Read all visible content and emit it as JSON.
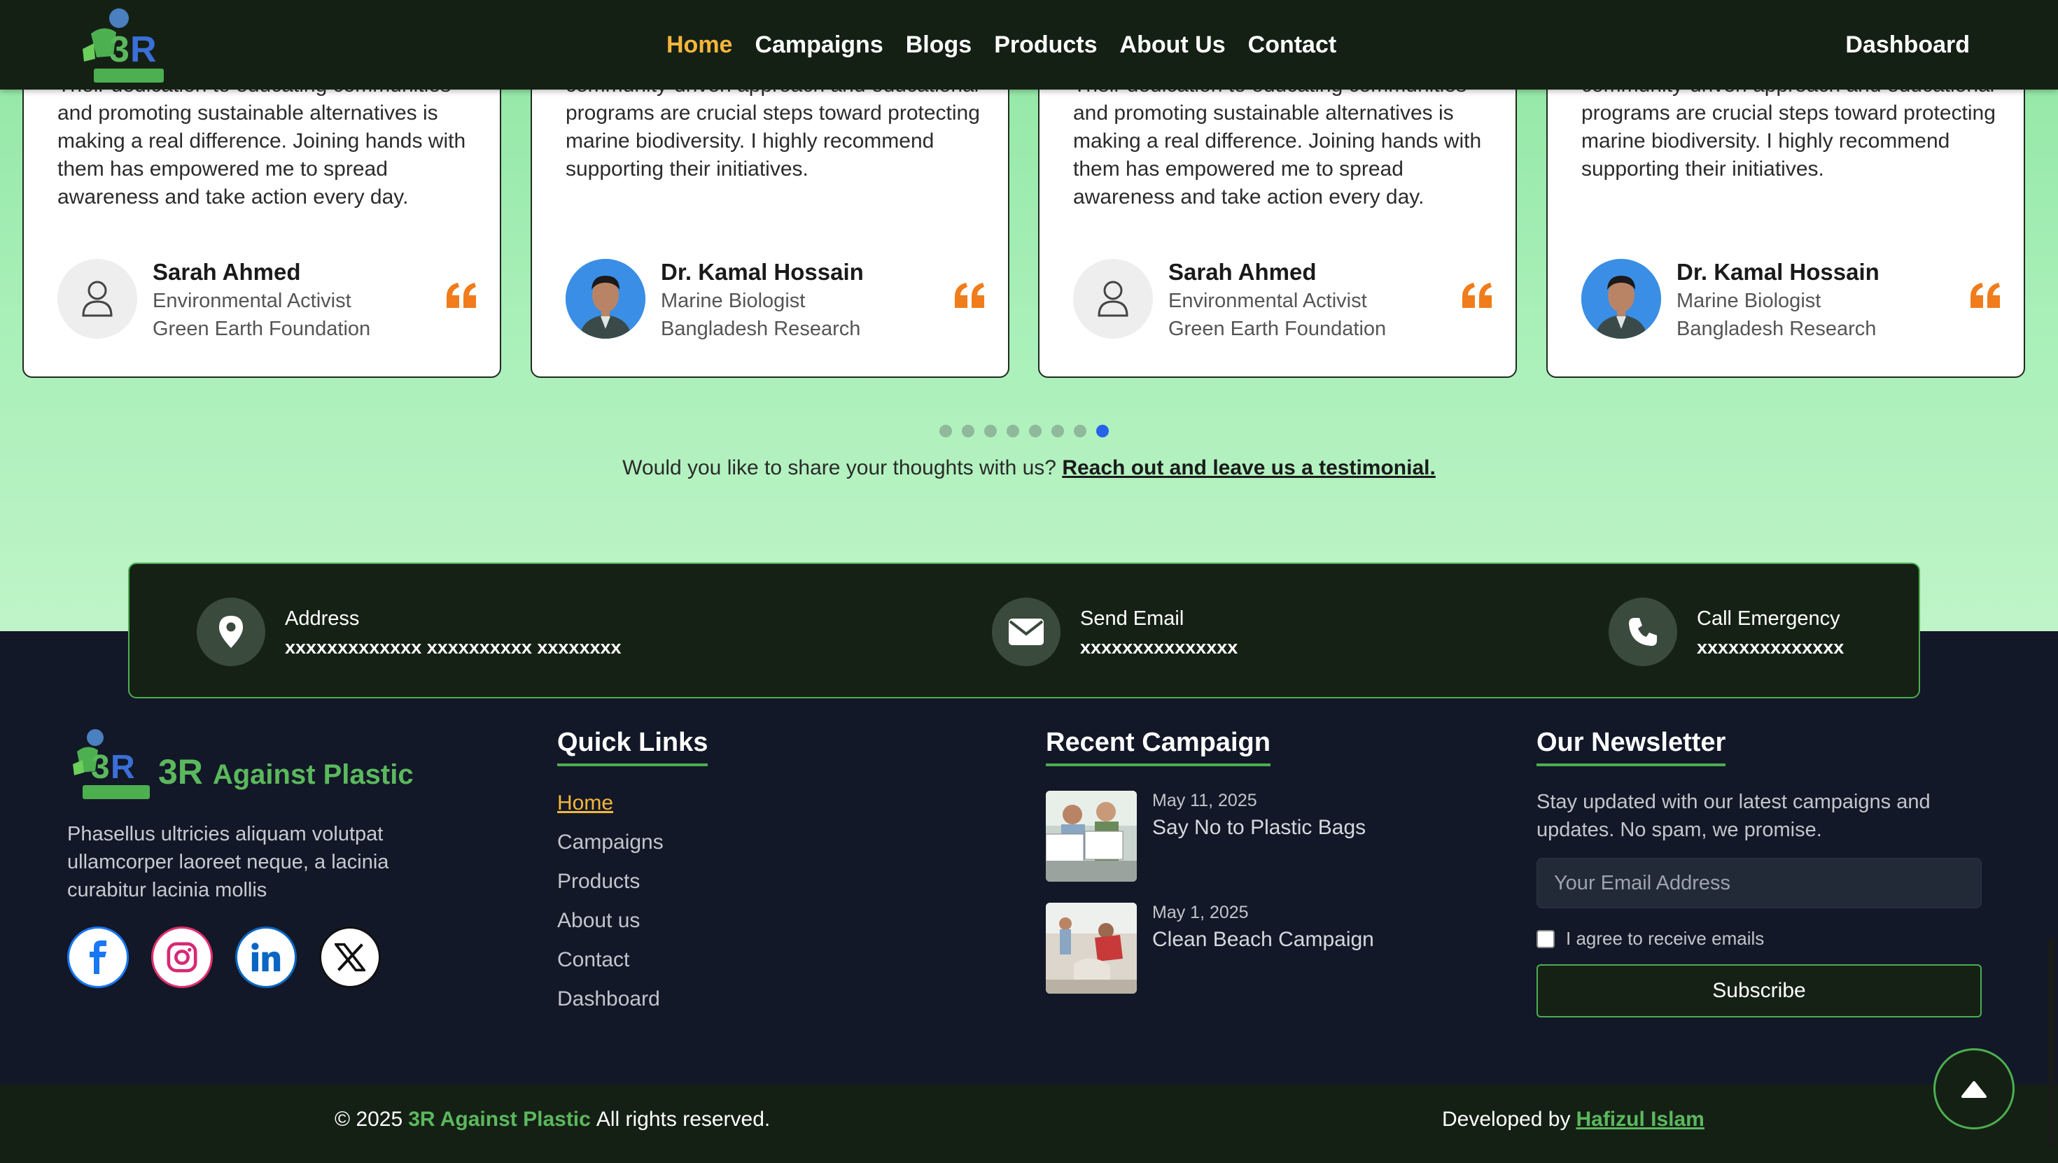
{
  "nav": {
    "links": [
      {
        "label": "Home",
        "active": true
      },
      {
        "label": "Campaigns"
      },
      {
        "label": "Blogs"
      },
      {
        "label": "Products"
      },
      {
        "label": "About Us"
      },
      {
        "label": "Contact"
      }
    ],
    "dashboard": "Dashboard"
  },
  "testimonials": {
    "cards": [
      {
        "text": "Their dedication to educating communities and promoting sustainable alternatives is making a real difference. Joining hands with them has empowered me to spread awareness and take action every day.",
        "name": "Sarah Ahmed",
        "role": "Environmental Activist",
        "org": "Green Earth Foundation",
        "avatar": "user-placeholder-icon"
      },
      {
        "text": "community-driven approach and educational programs are crucial steps toward protecting marine biodiversity. I highly recommend supporting their initiatives.",
        "name": "Dr. Kamal Hossain",
        "role": "Marine Biologist",
        "org": "Bangladesh Research",
        "avatar": "photo"
      },
      {
        "text": "Their dedication to educating communities and promoting sustainable alternatives is making a real difference. Joining hands with them has empowered me to spread awareness and take action every day.",
        "name": "Sarah Ahmed",
        "role": "Environmental Activist",
        "org": "Green Earth Foundation",
        "avatar": "user-placeholder-icon"
      },
      {
        "text": "community-driven approach and educational programs are crucial steps toward protecting marine biodiversity. I highly recommend supporting their initiatives.",
        "name": "Dr. Kamal Hossain",
        "role": "Marine Biologist",
        "org": "Bangladesh Research",
        "avatar": "photo"
      }
    ],
    "dots_total": 8,
    "active_dot": 8,
    "share_prefix": "Would you like to share your thoughts with us?",
    "share_link": "Reach out and leave us a testimonial."
  },
  "contact_bar": {
    "address_label": "Address",
    "address_value": "xxxxxxxxxxxxx xxxxxxxxxx xxxxxxxx",
    "email_label": "Send Email",
    "email_value": "xxxxxxxxxxxxxxx",
    "phone_label": "Call Emergency",
    "phone_value": "xxxxxxxxxxxxxx"
  },
  "footer": {
    "brand": "3R",
    "brand_suffix": "Against Plastic",
    "description": "Phasellus ultricies aliquam volutpat ullamcorper laoreet neque, a lacinia curabitur lacinia mollis",
    "quick_links_heading": "Quick Links",
    "quick_links": [
      "Home",
      "Campaigns",
      "Products",
      "About us",
      "Contact",
      "Dashboard"
    ],
    "recent_heading": "Recent Campaign",
    "recent": [
      {
        "date": "May 11, 2025",
        "title": "Say No to Plastic Bags"
      },
      {
        "date": "May 1, 2025",
        "title": "Clean Beach Campaign"
      }
    ],
    "newsletter_heading": "Our Newsletter",
    "newsletter_desc": "Stay updated with our latest campaigns and updates. No spam, we promise.",
    "newsletter_placeholder": "Your Email Address",
    "newsletter_checkbox": "I agree to receive emails",
    "newsletter_button": "Subscribe"
  },
  "bottom": {
    "copy_prefix": "© 2025",
    "copy_brand": "3R Against Plastic",
    "copy_suffix": "All rights reserved.",
    "dev_prefix": "Developed by",
    "dev_name": "Hafizul Islam"
  },
  "colors": {
    "accent_orange": "#f5b63b",
    "brand_green": "#5bb85d",
    "quote_orange": "#f07c1b",
    "footer_bg": "#121827",
    "nav_bg": "#152015"
  }
}
